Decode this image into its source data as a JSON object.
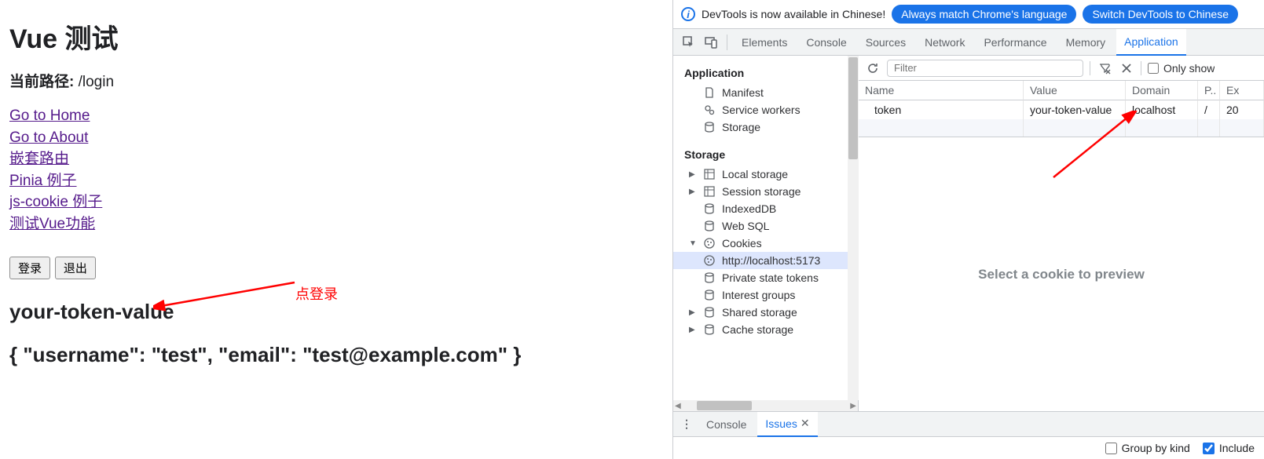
{
  "vue": {
    "title": "Vue 测试",
    "route_label": "当前路径:",
    "route_value": "/login",
    "links": [
      "Go to Home",
      "Go to About",
      "嵌套路由",
      "Pinia 例子",
      "js-cookie 例子",
      "测试Vue功能"
    ],
    "btn_login": "登录",
    "btn_logout": "退出",
    "annotation": "点登录",
    "token_display": "your-token-value",
    "user_display": "{ \"username\": \"test\", \"email\": \"test@example.com\" }"
  },
  "infobar": {
    "text": "DevTools is now available in Chinese!",
    "pill1": "Always match Chrome's language",
    "pill2": "Switch DevTools to Chinese"
  },
  "tabs": {
    "elements": "Elements",
    "console": "Console",
    "sources": "Sources",
    "network": "Network",
    "performance": "Performance",
    "memory": "Memory",
    "application": "Application"
  },
  "sidebar": {
    "application": "Application",
    "manifest": "Manifest",
    "service_workers": "Service workers",
    "storage_item": "Storage",
    "storage_section": "Storage",
    "local_storage": "Local storage",
    "session_storage": "Session storage",
    "indexeddb": "IndexedDB",
    "websql": "Web SQL",
    "cookies": "Cookies",
    "cookie_origin": "http://localhost:5173",
    "private_state": "Private state tokens",
    "interest_groups": "Interest groups",
    "shared_storage": "Shared storage",
    "cache_storage": "Cache storage"
  },
  "toolbar": {
    "filter_placeholder": "Filter",
    "only_show": "Only show"
  },
  "table": {
    "cols": {
      "name": "Name",
      "value": "Value",
      "domain": "Domain",
      "path": "P..",
      "expires": "Ex"
    },
    "row": {
      "name": "token",
      "value": "your-token-value",
      "domain": "localhost",
      "path": "/",
      "expires": "20"
    }
  },
  "preview_msg": "Select a cookie to preview",
  "drawer": {
    "console": "Console",
    "issues": "Issues",
    "group_by_kind": "Group by kind",
    "include": "Include"
  }
}
